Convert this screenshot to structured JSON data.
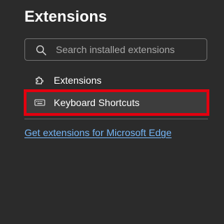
{
  "header": {
    "title": "Extensions"
  },
  "search": {
    "placeholder": "Search installed extensions",
    "value": "",
    "icon": "search-icon"
  },
  "nav": {
    "items": [
      {
        "label": "Extensions",
        "icon": "puzzle-piece-icon",
        "selected": false
      },
      {
        "label": "Keyboard Shortcuts",
        "icon": "keyboard-icon",
        "selected": true
      }
    ]
  },
  "footer": {
    "link_label": "Get extensions for Microsoft Edge"
  },
  "colors": {
    "background": "#2b2b2b",
    "selected_item": "#3d3d3d",
    "highlight": "#e3000f",
    "link": "#75b6f7"
  }
}
